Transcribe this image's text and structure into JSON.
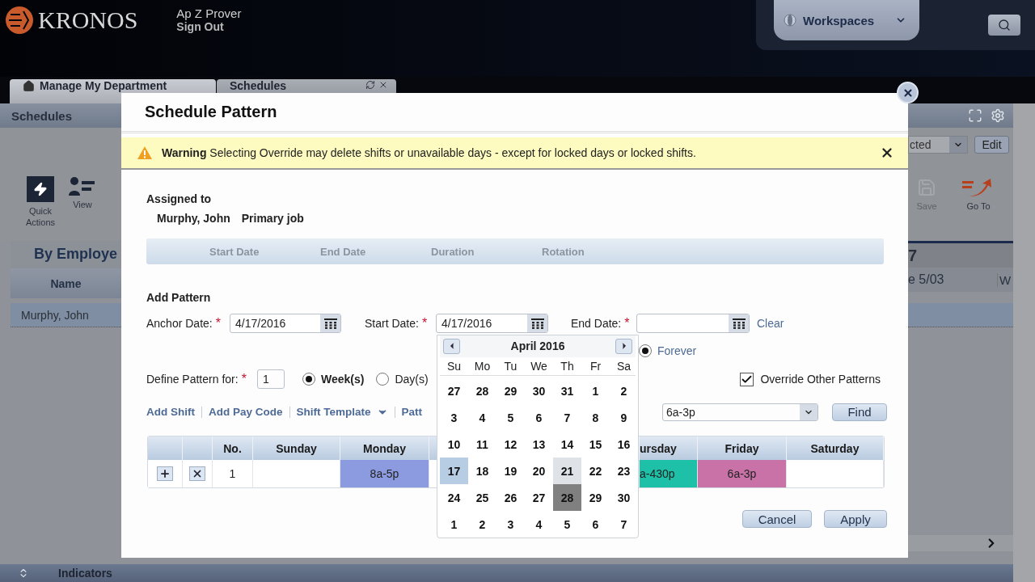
{
  "header": {
    "logo": "KRONOS",
    "user": "Ap Z Prover",
    "sign_out": "Sign Out",
    "workspaces": "Workspaces"
  },
  "tabs": [
    {
      "label": "Manage My Department",
      "selected": true,
      "kind": "home"
    },
    {
      "label": "Schedules",
      "selected": false,
      "kind": "closable"
    }
  ],
  "panel": {
    "title": "Schedules",
    "toolbar": {
      "quick_actions": "Quick Actions",
      "view": "View",
      "view_select": "cted",
      "edit": "Edit",
      "save": {
        "label": "Save",
        "disabled": true
      },
      "go_to": "Go To"
    },
    "grid": {
      "title": "By Employe",
      "name_column": "Name",
      "week_label": "7",
      "day_column": "e 5/03",
      "next_day_column": "W",
      "rows": [
        {
          "name": "Murphy, John",
          "selected": true
        }
      ]
    }
  },
  "footer": {
    "label": "Indicators"
  },
  "dialog": {
    "title": "Schedule Pattern",
    "warning": "**Warning** Selecting Override may delete shifts or unavailable days - except for locked days or locked shifts.",
    "assigned": {
      "label": "Assigned to",
      "name": "Murphy, John",
      "job": "Primary job"
    },
    "pattern_columns": [
      "Start Date",
      "End Date",
      "Duration",
      "Rotation"
    ],
    "required_mark": "*",
    "add_pattern": {
      "title": "Add Pattern",
      "anchor_label": "Anchor Date:",
      "anchor_value": "4/17/2016",
      "start_label": "Start Date:",
      "start_value": "4/17/2016",
      "end_label": "End Date:",
      "clear": "Clear",
      "forever": {
        "label": "Forever",
        "selected": true
      }
    },
    "define": {
      "label": "Define Pattern for:",
      "value": "1",
      "units": [
        {
          "label": "Week(s)",
          "selected": true
        },
        {
          "label": "Day(s)",
          "selected": false
        }
      ]
    },
    "override": {
      "label": "Override Other Patterns",
      "checked": true
    },
    "links": [
      {
        "label": "Add Shift",
        "dropdown": false
      },
      {
        "label": "Add Pay Code",
        "dropdown": false
      },
      {
        "label": "Shift Template",
        "dropdown": true
      },
      {
        "label": "Patt",
        "dropdown": false
      }
    ],
    "shift_select": "6a-3p",
    "find": "Find",
    "table": {
      "columns": [
        "No.",
        "Sunday",
        "Monday",
        "ursday",
        "Friday",
        "Saturday"
      ],
      "rows": [
        {
          "cells": [
            {
              "kind": "number",
              "text": "1"
            },
            {
              "kind": "empty"
            },
            {
              "kind": "shift",
              "text": "8a-5p",
              "color": "#8c9be0"
            },
            {
              "kind": "shift",
              "text": "a-430p",
              "color": "#1ec0a8"
            },
            {
              "kind": "shift",
              "text": "6a-3p",
              "color": "#c872a8"
            },
            {
              "kind": "empty"
            }
          ]
        }
      ]
    },
    "buttons": [
      "Cancel",
      "Apply"
    ],
    "calendar": {
      "month": "April 2016",
      "weekdays": [
        "Su",
        "Mo",
        "Tu",
        "We",
        "Th",
        "Fr",
        "Sa"
      ],
      "weeks": [
        [
          {
            "d": "27",
            "selected": false
          },
          {
            "d": "28",
            "selected": false
          },
          {
            "d": "29",
            "selected": false
          },
          {
            "d": "30",
            "selected": false
          },
          {
            "d": "31",
            "selected": false
          },
          {
            "d": "1",
            "selected": false
          },
          {
            "d": "2",
            "selected": false
          }
        ],
        [
          {
            "d": "3",
            "selected": false
          },
          {
            "d": "4",
            "selected": false
          },
          {
            "d": "5",
            "selected": false
          },
          {
            "d": "6",
            "selected": false
          },
          {
            "d": "7",
            "selected": false
          },
          {
            "d": "8",
            "selected": false
          },
          {
            "d": "9",
            "selected": false
          }
        ],
        [
          {
            "d": "10",
            "selected": false
          },
          {
            "d": "11",
            "selected": false
          },
          {
            "d": "12",
            "selected": false
          },
          {
            "d": "13",
            "selected": false
          },
          {
            "d": "14",
            "selected": false
          },
          {
            "d": "15",
            "selected": false
          },
          {
            "d": "16",
            "selected": false
          }
        ],
        [
          {
            "d": "17",
            "selected": true
          },
          {
            "d": "18",
            "selected": false
          },
          {
            "d": "19",
            "selected": false
          },
          {
            "d": "20",
            "selected": false
          },
          {
            "d": "21",
            "selected": false,
            "hover": true
          },
          {
            "d": "22",
            "selected": false
          },
          {
            "d": "23",
            "selected": false
          }
        ],
        [
          {
            "d": "24",
            "selected": false
          },
          {
            "d": "25",
            "selected": false
          },
          {
            "d": "26",
            "selected": false
          },
          {
            "d": "27",
            "selected": false
          },
          {
            "d": "28",
            "selected": false,
            "today": true
          },
          {
            "d": "29",
            "selected": false
          },
          {
            "d": "30",
            "selected": false
          }
        ],
        [
          {
            "d": "1",
            "selected": false
          },
          {
            "d": "2",
            "selected": false
          },
          {
            "d": "3",
            "selected": false
          },
          {
            "d": "4",
            "selected": false
          },
          {
            "d": "5",
            "selected": false
          },
          {
            "d": "6",
            "selected": false
          },
          {
            "d": "7",
            "selected": false
          }
        ]
      ]
    }
  }
}
